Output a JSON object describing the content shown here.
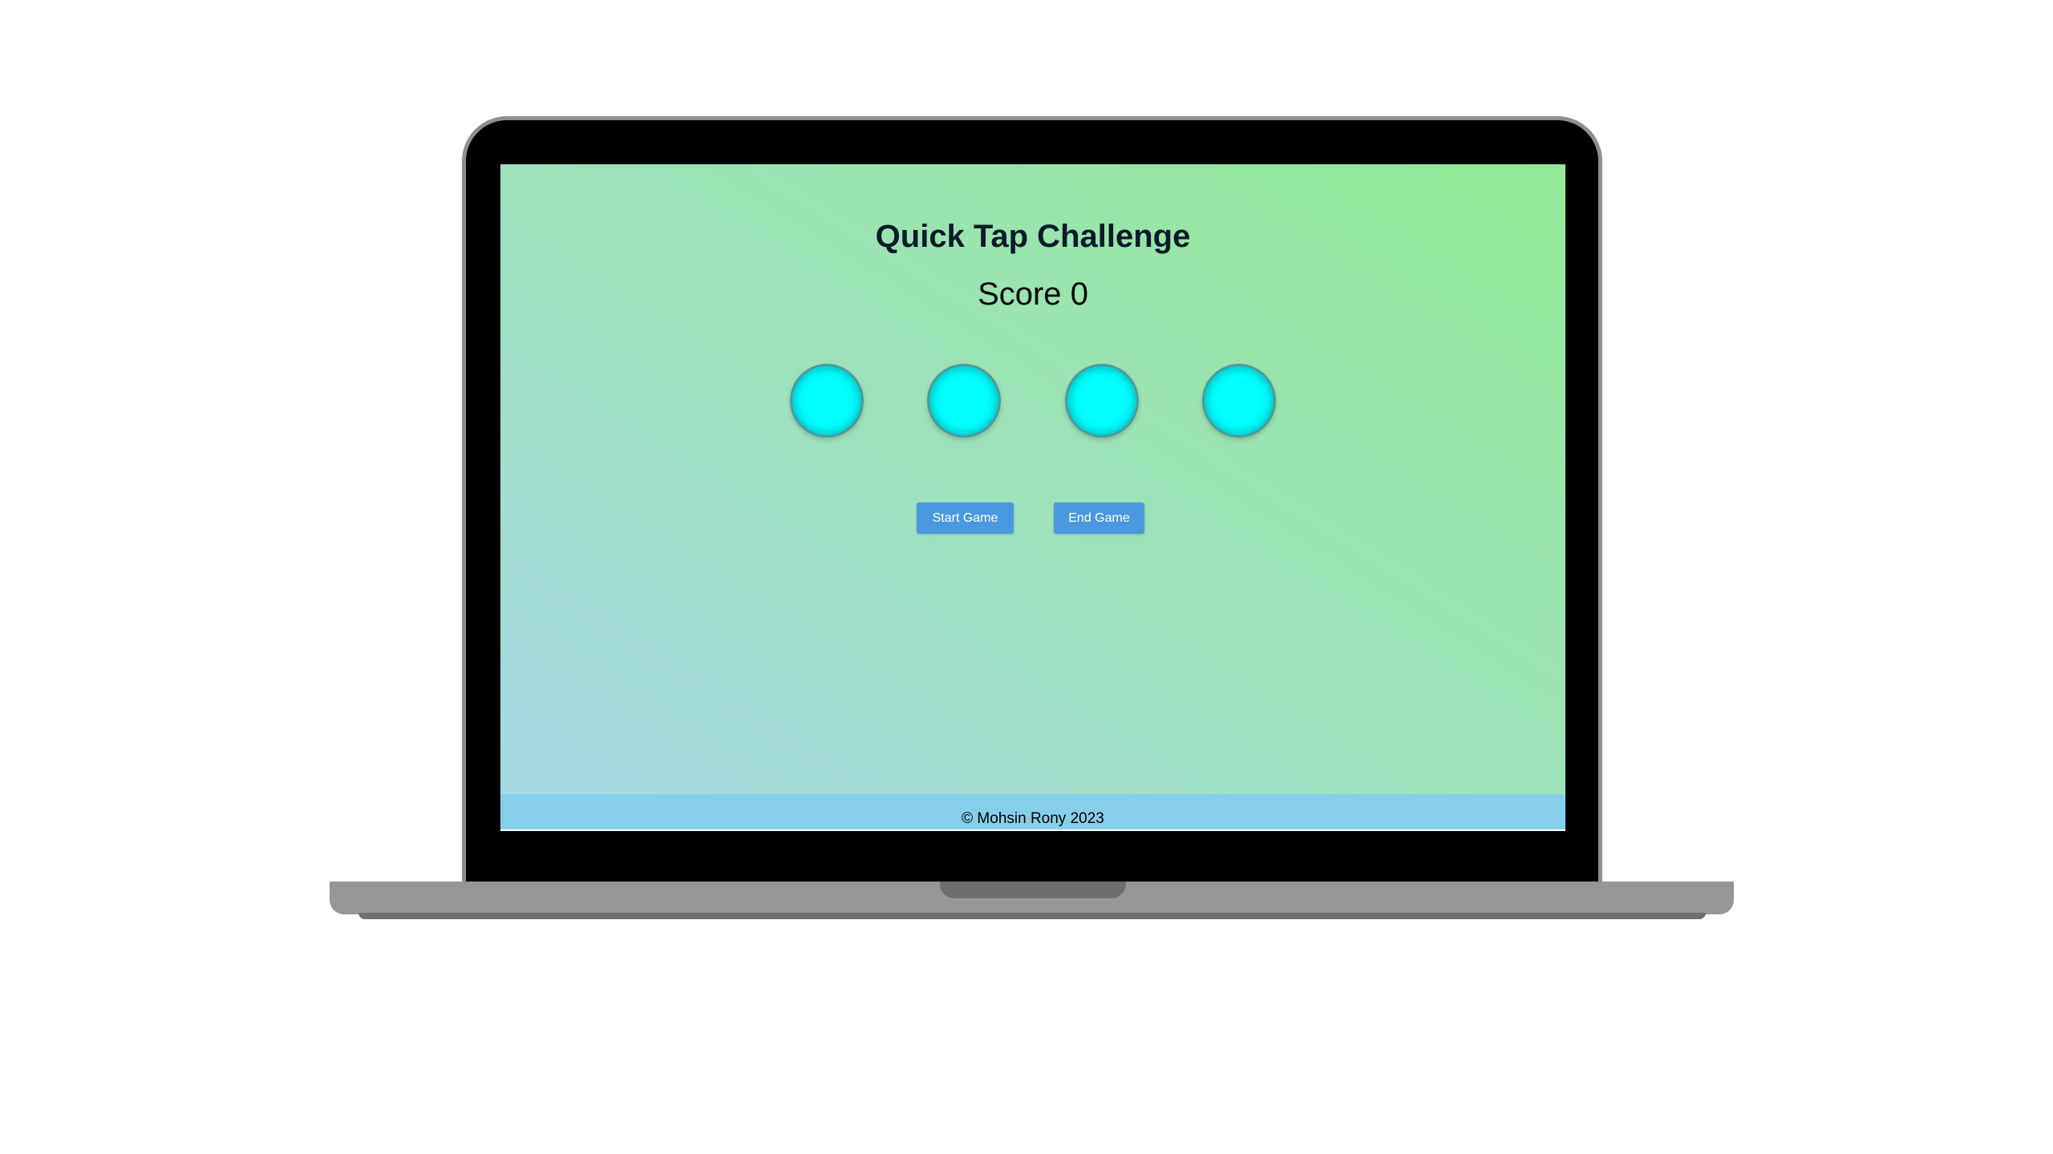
{
  "app": {
    "title": "Quick Tap Challenge",
    "score_label": "Score",
    "score_value": "0"
  },
  "circles": [
    {
      "name": "tap-circle-1",
      "color": "#00ffff"
    },
    {
      "name": "tap-circle-2",
      "color": "#00ffff"
    },
    {
      "name": "tap-circle-3",
      "color": "#00ffff"
    },
    {
      "name": "tap-circle-4",
      "color": "#00ffff"
    }
  ],
  "controls": {
    "start_label": "Start Game",
    "end_label": "End Game"
  },
  "footer": {
    "text": "© Mohsin Rony 2023"
  },
  "colors": {
    "button": "#4a98e0",
    "footer_bg": "#87ceeb",
    "gradient_start": "#a7d8e6",
    "gradient_end": "#93e995",
    "circle": "#00ffff"
  }
}
